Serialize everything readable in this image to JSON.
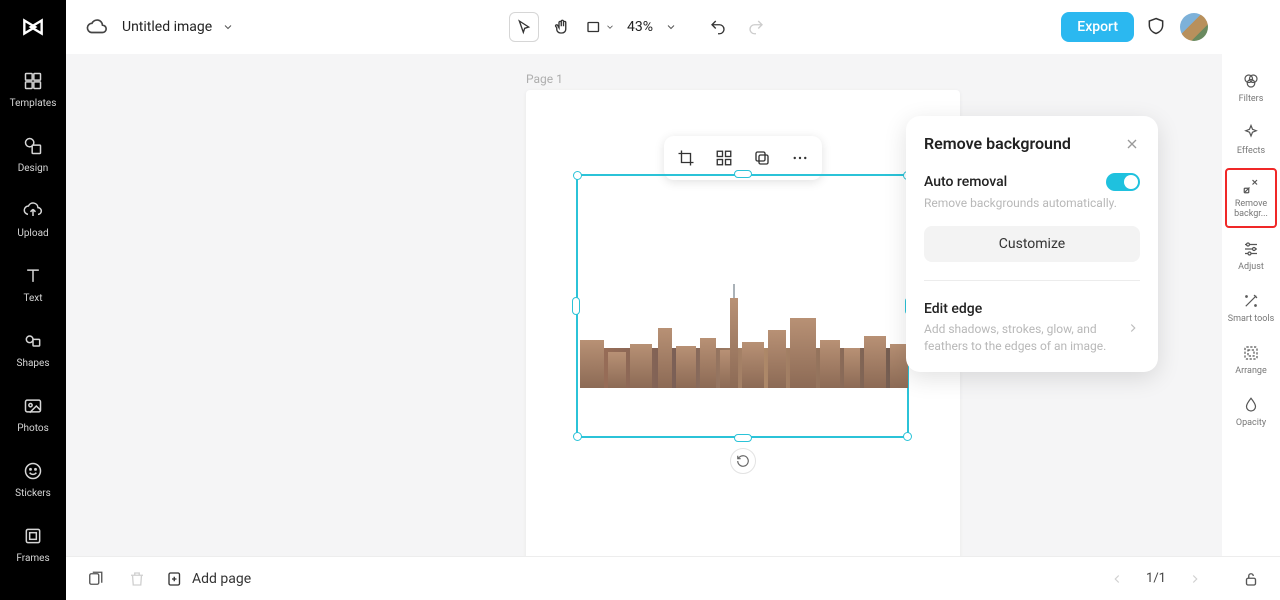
{
  "app": {
    "title": "Untitled image"
  },
  "sidebar": {
    "items": [
      {
        "label": "Templates"
      },
      {
        "label": "Design"
      },
      {
        "label": "Upload"
      },
      {
        "label": "Text"
      },
      {
        "label": "Shapes"
      },
      {
        "label": "Photos"
      },
      {
        "label": "Stickers"
      },
      {
        "label": "Frames"
      }
    ]
  },
  "topbar": {
    "zoom": "43%",
    "export_label": "Export"
  },
  "canvas": {
    "page_label": "Page 1"
  },
  "popup": {
    "title": "Remove background",
    "auto_removal": {
      "title": "Auto removal",
      "desc": "Remove backgrounds automatically."
    },
    "customize_label": "Customize",
    "edit_edge": {
      "title": "Edit edge",
      "desc": "Add shadows, strokes, glow, and feathers to the edges of an image."
    }
  },
  "right_rail": {
    "items": [
      {
        "label": "Filters"
      },
      {
        "label": "Effects"
      },
      {
        "label": "Remove backgr..."
      },
      {
        "label": "Adjust"
      },
      {
        "label": "Smart tools"
      },
      {
        "label": "Arrange"
      },
      {
        "label": "Opacity"
      }
    ]
  },
  "bottombar": {
    "add_page_label": "Add page",
    "page_indicator": "1/1"
  }
}
